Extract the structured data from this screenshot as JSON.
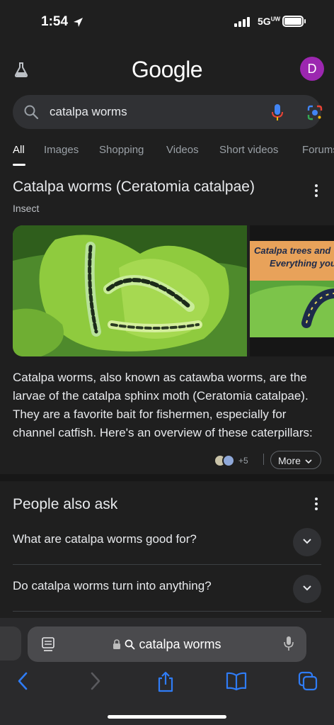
{
  "status_bar": {
    "time": "1:54",
    "network": "5G",
    "network_sub": "UW"
  },
  "header": {
    "logo": "Google",
    "avatar_letter": "D",
    "avatar_color": "#9c27b0"
  },
  "search": {
    "query": "catalpa worms"
  },
  "tabs": [
    {
      "label": "All",
      "active": true
    },
    {
      "label": "Images"
    },
    {
      "label": "Shopping"
    },
    {
      "label": "Videos"
    },
    {
      "label": "Short videos"
    },
    {
      "label": "Forums"
    }
  ],
  "knowledge_panel": {
    "title": "Catalpa worms (Ceratomia catalpae)",
    "subtitle": "Insect",
    "image2_caption_line1": "Catalpa trees and",
    "image2_caption_line2": "Everything you",
    "description": "Catalpa worms, also known as catawba worms, are the larvae of the catalpa sphinx moth (Ceratomia catalpae). They are a favorite bait for fishermen, especially for channel catfish. Here's an overview of these caterpillars:",
    "sources_more_count": "+5",
    "more_label": "More"
  },
  "people_also_ask": {
    "heading": "People also ask",
    "questions": [
      "What are catalpa worms good for?",
      "Do catalpa worms turn into anything?"
    ]
  },
  "browser": {
    "url_text": "catalpa worms"
  },
  "colors": {
    "background": "#1f1f1f",
    "search_bg": "#303134",
    "accent_blue": "#4285f4",
    "toolbar_blue": "#2f7cf6"
  }
}
